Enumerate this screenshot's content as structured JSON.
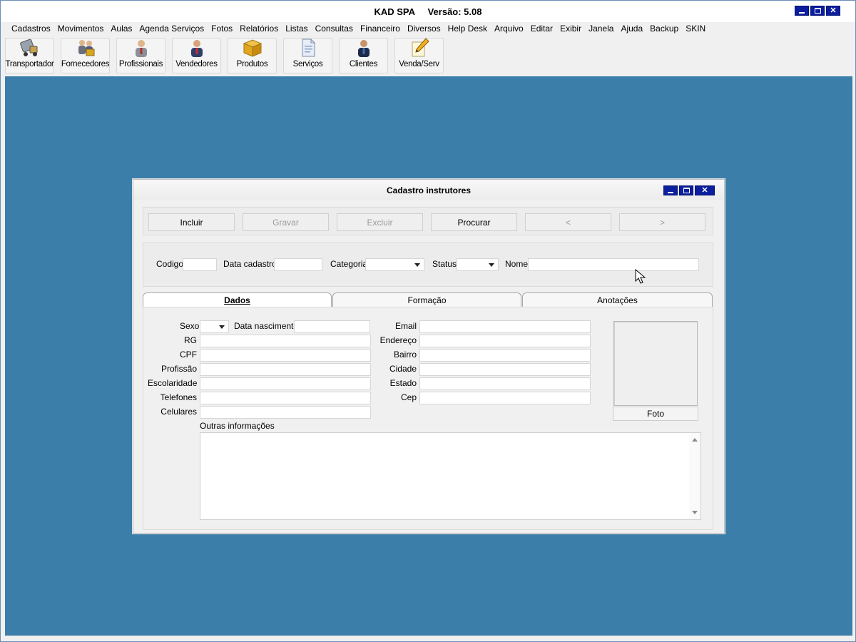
{
  "app": {
    "title": "KAD SPA     Versão: 5.08"
  },
  "menu": [
    "Cadastros",
    "Movimentos",
    "Aulas",
    "Agenda Serviços",
    "Fotos",
    "Relatórios",
    "Listas",
    "Consultas",
    "Financeiro",
    "Diversos",
    "Help Desk",
    "Arquivo",
    "Editar",
    "Exibir",
    "Janela",
    "Ajuda",
    "Backup",
    "SKIN"
  ],
  "toolbar": [
    {
      "label": "Transportador",
      "icon": "truck-icon"
    },
    {
      "label": "Fornecedores",
      "icon": "suppliers-icon"
    },
    {
      "label": "Profissionais",
      "icon": "professional-icon"
    },
    {
      "label": "Vendedores",
      "icon": "salesperson-icon"
    },
    {
      "label": "Produtos",
      "icon": "box-icon"
    },
    {
      "label": "Serviços",
      "icon": "document-icon"
    },
    {
      "label": "Clientes",
      "icon": "client-icon"
    },
    {
      "label": "Venda/Serv",
      "icon": "pencil-note-icon"
    }
  ],
  "window": {
    "title": "Cadastro instrutores"
  },
  "actions": {
    "incluir": "Incluir",
    "gravar": "Gravar",
    "excluir": "Excluir",
    "procurar": "Procurar",
    "prev": "<",
    "next": ">"
  },
  "filters": {
    "codigo": "Codigo",
    "data_cadastro": "Data cadastro",
    "categoria": "Categoria",
    "status": "Status",
    "nome": "Nome"
  },
  "tabs": {
    "dados": "Dados",
    "formacao": "Formação",
    "anotacoes": "Anotações"
  },
  "form": {
    "sexo": "Sexo",
    "data_nascimento": "Data nascimento",
    "rg": "RG",
    "cpf": "CPF",
    "profissao": "Profissão",
    "escolaridade": "Escolaridade",
    "telefones": "Telefones",
    "celulares": "Celulares",
    "email": "Email",
    "endereco": "Endereço",
    "bairro": "Bairro",
    "cidade": "Cidade",
    "estado": "Estado",
    "cep": "Cep",
    "foto": "Foto",
    "outras": "Outras informações"
  },
  "colors": {
    "desktop": "#3b7ea9",
    "winbtn": "#0a1e9e"
  }
}
